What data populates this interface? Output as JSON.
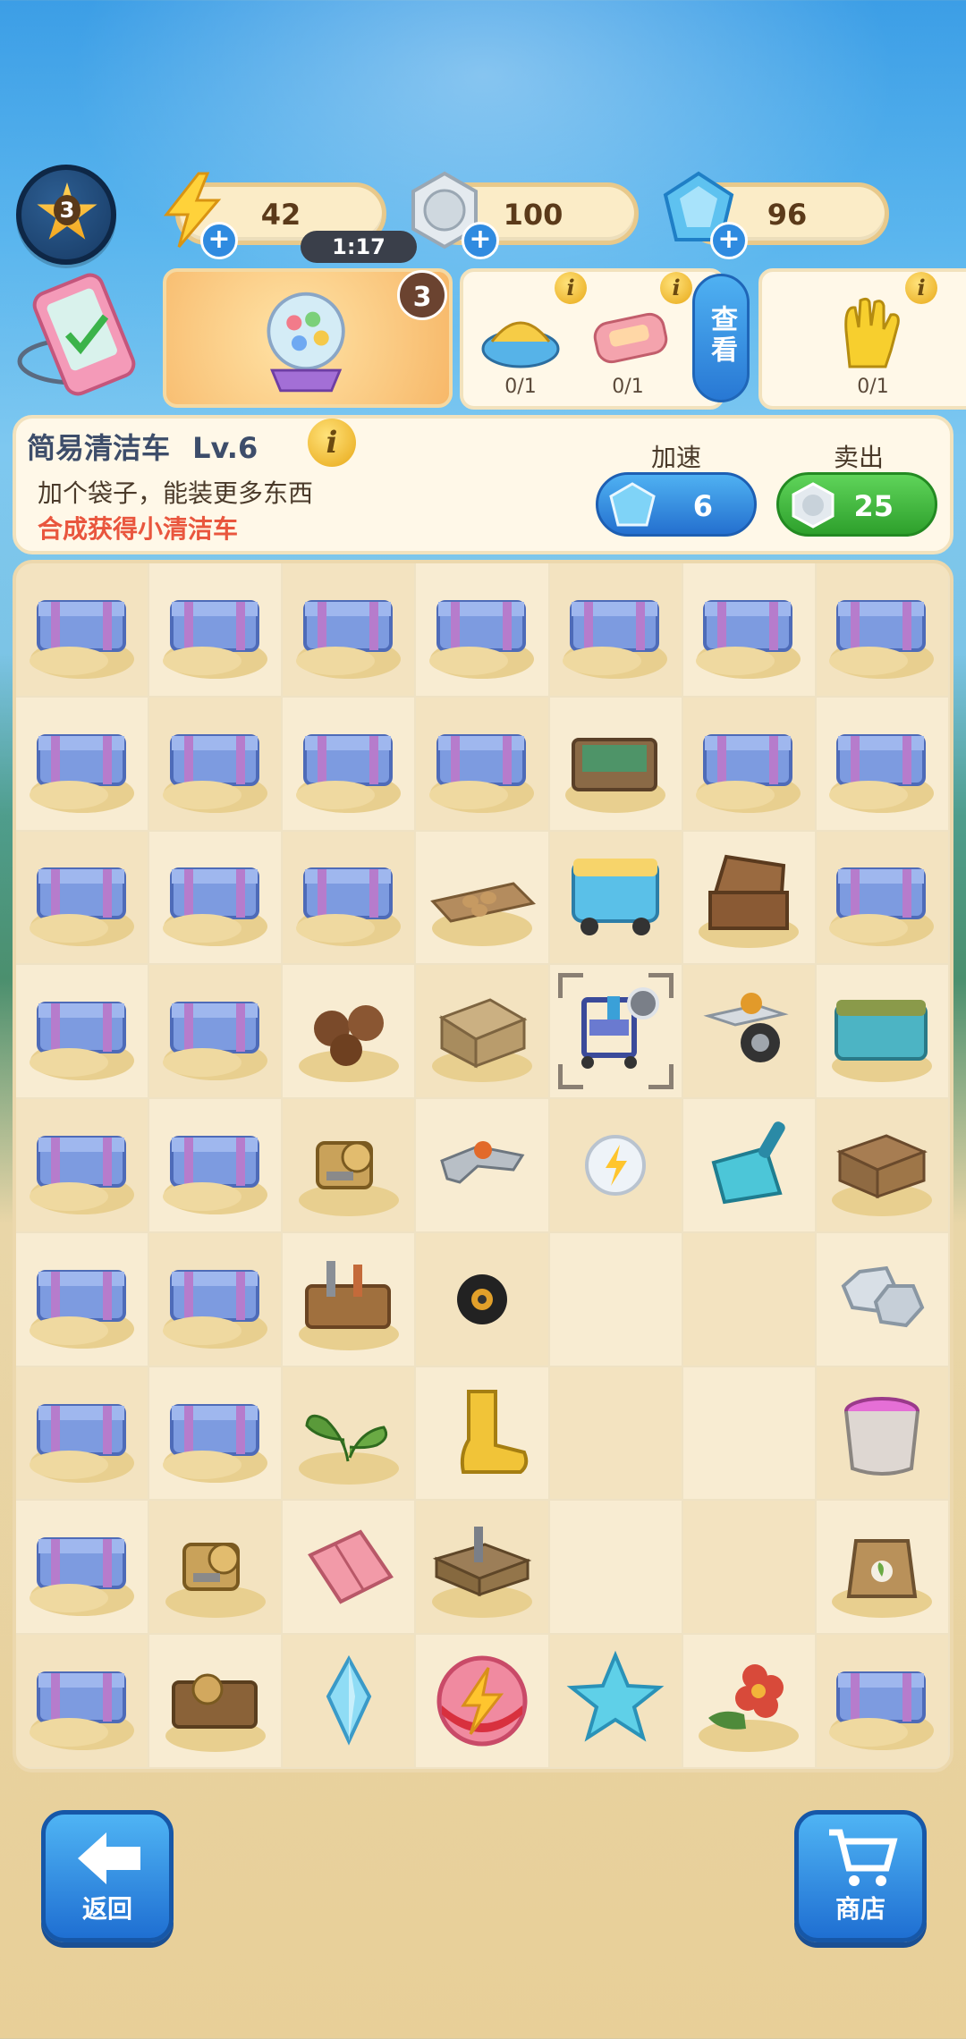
{
  "header": {
    "level": "3",
    "energy": "42",
    "energy_timer": "1:17",
    "coins": "100",
    "gems": "96"
  },
  "quests": {
    "gacha_count": "3",
    "requirements": [
      {
        "icon": "sandal-icon",
        "progress": "0/1"
      },
      {
        "icon": "soap-icon",
        "progress": "0/1"
      },
      {
        "icon": "gloves-icon",
        "progress": "0/1"
      }
    ],
    "view_label": "查看"
  },
  "item_panel": {
    "title": "简易清洁车",
    "level": "Lv.6",
    "description": "加个袋子，能装更多东西",
    "hint": "合成获得小清洁车",
    "speed_label": "加速",
    "speed_cost": "6",
    "sell_label": "卖出",
    "sell_price": "25"
  },
  "board": {
    "columns": 7,
    "rows": [
      [
        "crate",
        "crate",
        "crate",
        "crate",
        "crate",
        "crate",
        "crate"
      ],
      [
        "crate",
        "crate",
        "crate",
        "crate",
        "green-crate",
        "crate",
        "crate"
      ],
      [
        "crate",
        "crate",
        "crate",
        "egg-tray",
        "ice-cart",
        "treasure-chest",
        "crate"
      ],
      [
        "crate",
        "crate",
        "coconuts",
        "wooden-box",
        "cleaning-cart",
        "caster-wheel",
        "cooler-cart"
      ],
      [
        "crate",
        "crate",
        "gold-gears",
        "metal-bracket",
        "energy-orb-small",
        "dustpan",
        "wooden-crate"
      ],
      [
        "crate",
        "crate",
        "toolbox",
        "black-wheel",
        "empty",
        "empty",
        "coins"
      ],
      [
        "crate",
        "crate",
        "sprout",
        "rain-boot",
        "empty",
        "empty",
        "paint-bucket"
      ],
      [
        "crate",
        "gold-gears",
        "pink-wallet",
        "tool-tray",
        "empty",
        "empty",
        "seed-bag"
      ],
      [
        "crate",
        "gear-crate",
        "blue-crystal",
        "energy-orb",
        "blue-star",
        "red-flower",
        "crate"
      ]
    ],
    "selected": "cleaning-cart"
  },
  "nav": {
    "back_label": "返回",
    "shop_label": "商店"
  },
  "colors": {
    "accent_blue": "#2f8be0",
    "accent_green": "#2ea02c",
    "hint_red": "#e9563e",
    "panel_bg": "#fff8e8"
  }
}
